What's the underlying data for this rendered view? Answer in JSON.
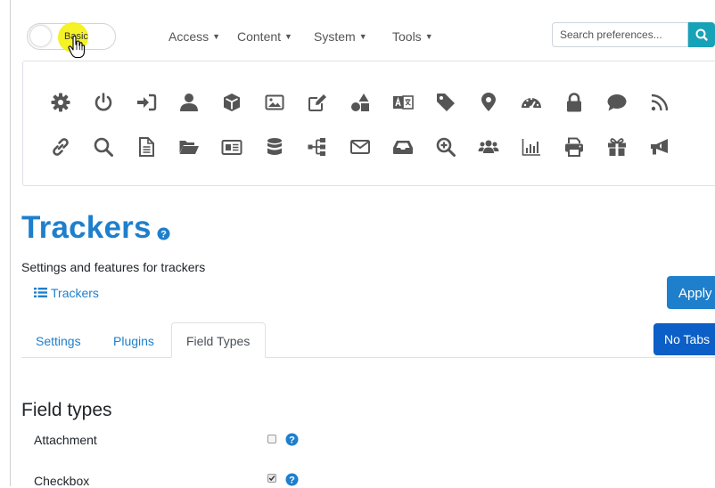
{
  "header": {
    "mode_toggle_label": "Basic",
    "nav": [
      {
        "label": "Access"
      },
      {
        "label": "Content"
      },
      {
        "label": "System"
      },
      {
        "label": "Tools"
      }
    ],
    "search_placeholder": "Search preferences..."
  },
  "icons_row1": [
    "gear-icon",
    "power-icon",
    "sign-in-icon",
    "user-icon",
    "cube-icon",
    "image-icon",
    "edit-icon",
    "shapes-icon",
    "language-icon",
    "tag-icon",
    "map-marker-icon",
    "dashboard-icon",
    "lock-icon",
    "comment-icon",
    "rss-icon"
  ],
  "icons_row2": [
    "link-icon",
    "search-icon",
    "file-icon",
    "folder-open-icon",
    "newspaper-icon",
    "database-icon",
    "sitemap-icon",
    "envelope-icon",
    "inbox-icon",
    "zoom-in-icon",
    "users-icon",
    "chart-bar-icon",
    "print-icon",
    "gift-icon",
    "bullhorn-icon"
  ],
  "page": {
    "title": "Trackers",
    "subtitle": "Settings and features for trackers",
    "trackers_link": "Trackers",
    "apply_label": "Apply",
    "no_tabs_label": "No Tabs"
  },
  "tabs": [
    {
      "label": "Settings",
      "active": false
    },
    {
      "label": "Plugins",
      "active": false
    },
    {
      "label": "Field Types",
      "active": true
    }
  ],
  "section": {
    "title": "Field types",
    "fields": [
      {
        "label": "Attachment",
        "checked": false
      },
      {
        "label": "Checkbox",
        "checked": true
      }
    ]
  },
  "colors": {
    "primary": "#1e7fcc",
    "info": "#17a2b8",
    "icon": "#555555",
    "highlight": "#f3f000"
  }
}
